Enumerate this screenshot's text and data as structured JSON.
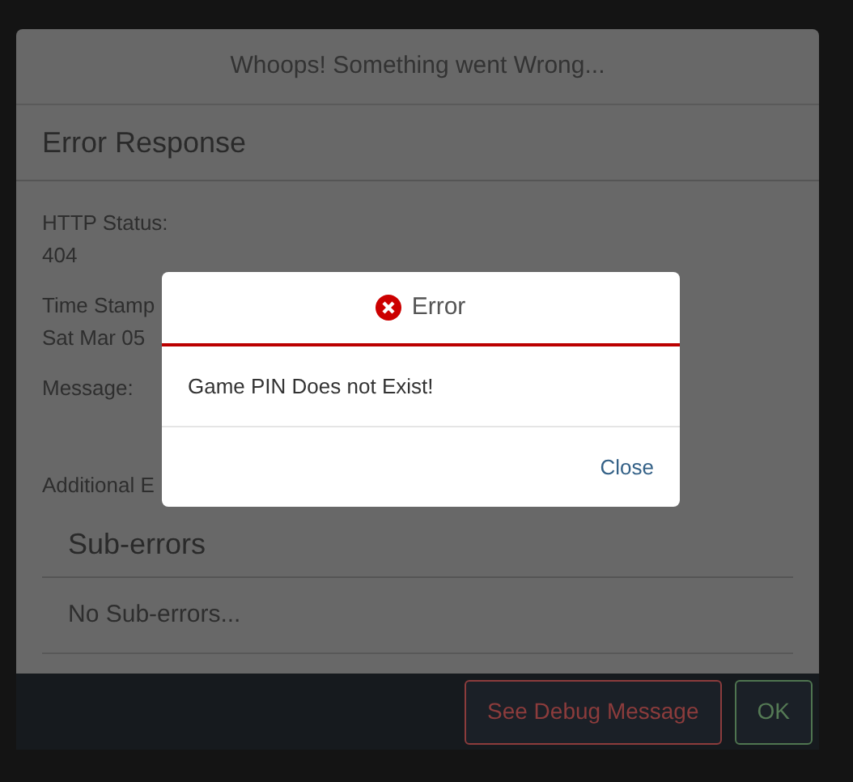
{
  "background_dialog": {
    "title": "Whoops! Something went Wrong...",
    "section_title": "Error Response",
    "fields": [
      {
        "label": "HTTP Status:",
        "value": "404"
      },
      {
        "label": "Time Stamp",
        "value": "Sat Mar 05"
      },
      {
        "label": "Message:"
      },
      {
        "label": "Additional E"
      }
    ],
    "subsection_title": "Sub-errors",
    "subsection_text": "No Sub-errors...",
    "buttons": [
      {
        "label": "See Debug Message",
        "kind": "danger"
      },
      {
        "label": "OK",
        "kind": "success"
      }
    ]
  },
  "error_dialog": {
    "title": "Error",
    "message": "Game PIN Does not Exist!",
    "button": "Close"
  }
}
